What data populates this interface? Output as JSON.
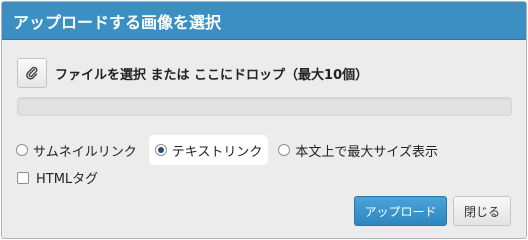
{
  "dialog": {
    "title": "アップロードする画像を選択",
    "select_text": "ファイルを選択 または ここにドロップ（最大10個）",
    "clip_icon": "paperclip-icon",
    "progress": 0,
    "link_options": [
      {
        "label": "サムネイルリンク",
        "checked": false
      },
      {
        "label": "テキストリンク",
        "checked": true
      },
      {
        "label": "本文上で最大サイズ表示",
        "checked": false
      }
    ],
    "html_tag_label": "HTMLタグ",
    "html_tag_checked": false,
    "upload_button": "アップロード",
    "close_button": "閉じる"
  },
  "colors": {
    "title_bar": "#3b8fc2",
    "upload_button": "#3a94cf",
    "background": "#ececec"
  }
}
